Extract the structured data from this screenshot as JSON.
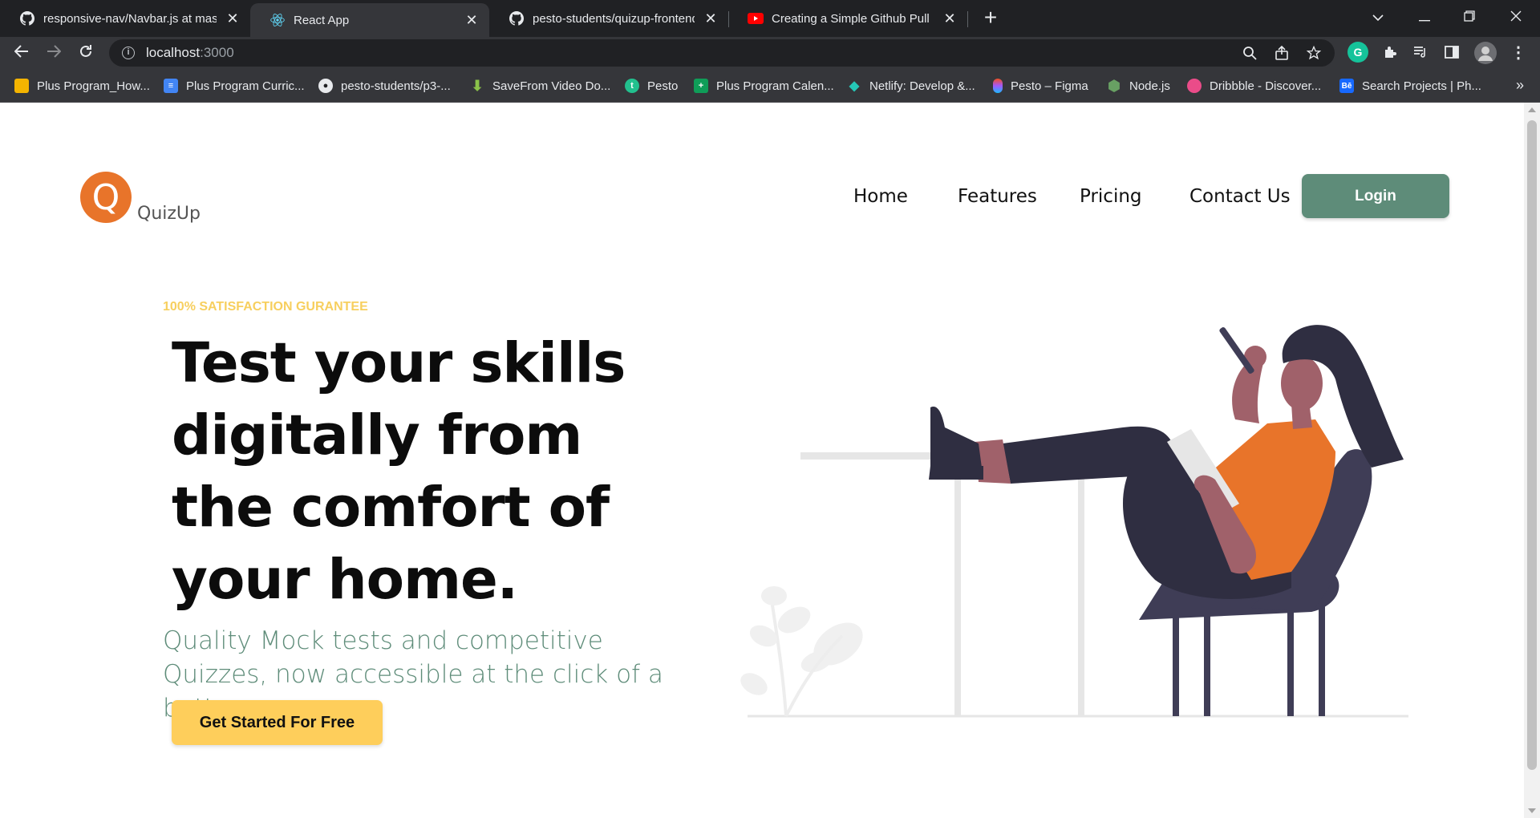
{
  "browser": {
    "tabs": [
      {
        "title": "responsive-nav/Navbar.js at mast",
        "icon": "github-icon",
        "active": false
      },
      {
        "title": "React App",
        "icon": "react-icon",
        "active": true
      },
      {
        "title": "pesto-students/quizup-frontend",
        "icon": "github-icon",
        "active": false
      },
      {
        "title": "Creating a Simple Github Pull Re",
        "icon": "youtube-icon",
        "active": false
      }
    ],
    "tab_close_glyph": "✕",
    "new_tab_glyph": "+",
    "url_host": "localhost",
    "url_port": ":3000",
    "bookmarks": [
      {
        "label": "Plus Program_How...",
        "color": "#f4b400"
      },
      {
        "label": "Plus Program Curric...",
        "color": "#4285f4"
      },
      {
        "label": "pesto-students/p3-...",
        "color": "#202124"
      },
      {
        "label": "SaveFrom Video Do...",
        "color": "#8bc34a"
      },
      {
        "label": "Pesto",
        "color": "#22c08e"
      },
      {
        "label": "Plus Program Calen...",
        "color": "#0f9d58"
      },
      {
        "label": "Netlify: Develop &...",
        "color": "#25c7b7"
      },
      {
        "label": "Pesto – Figma",
        "color": "#f24e1e"
      },
      {
        "label": "Node.js",
        "color": "#68a063"
      },
      {
        "label": "Dribbble - Discover...",
        "color": "#ea4c89"
      },
      {
        "label": "Search Projects | Ph...",
        "color": "#1769ff"
      }
    ],
    "bookmarks_more": "»"
  },
  "app": {
    "logo_letter": "Q",
    "logo_text": "QuizUp",
    "nav": [
      "Home",
      "Features",
      "Pricing",
      "Contact Us"
    ],
    "login_label": "Login"
  },
  "hero": {
    "tagline": "100% SATISFACTION GURANTEE",
    "headline": "Test your skills digitally from the comfort of your home.",
    "subtext": "Quality Mock tests and competitive Quizzes, now accessible at the click of a button.",
    "cta_label": "Get Started For Free"
  },
  "colors": {
    "brand_orange": "#e8742a",
    "brand_green": "#5e8c79",
    "accent_yellow": "#fece5b",
    "tagline_yellow": "#f7cf5e"
  }
}
